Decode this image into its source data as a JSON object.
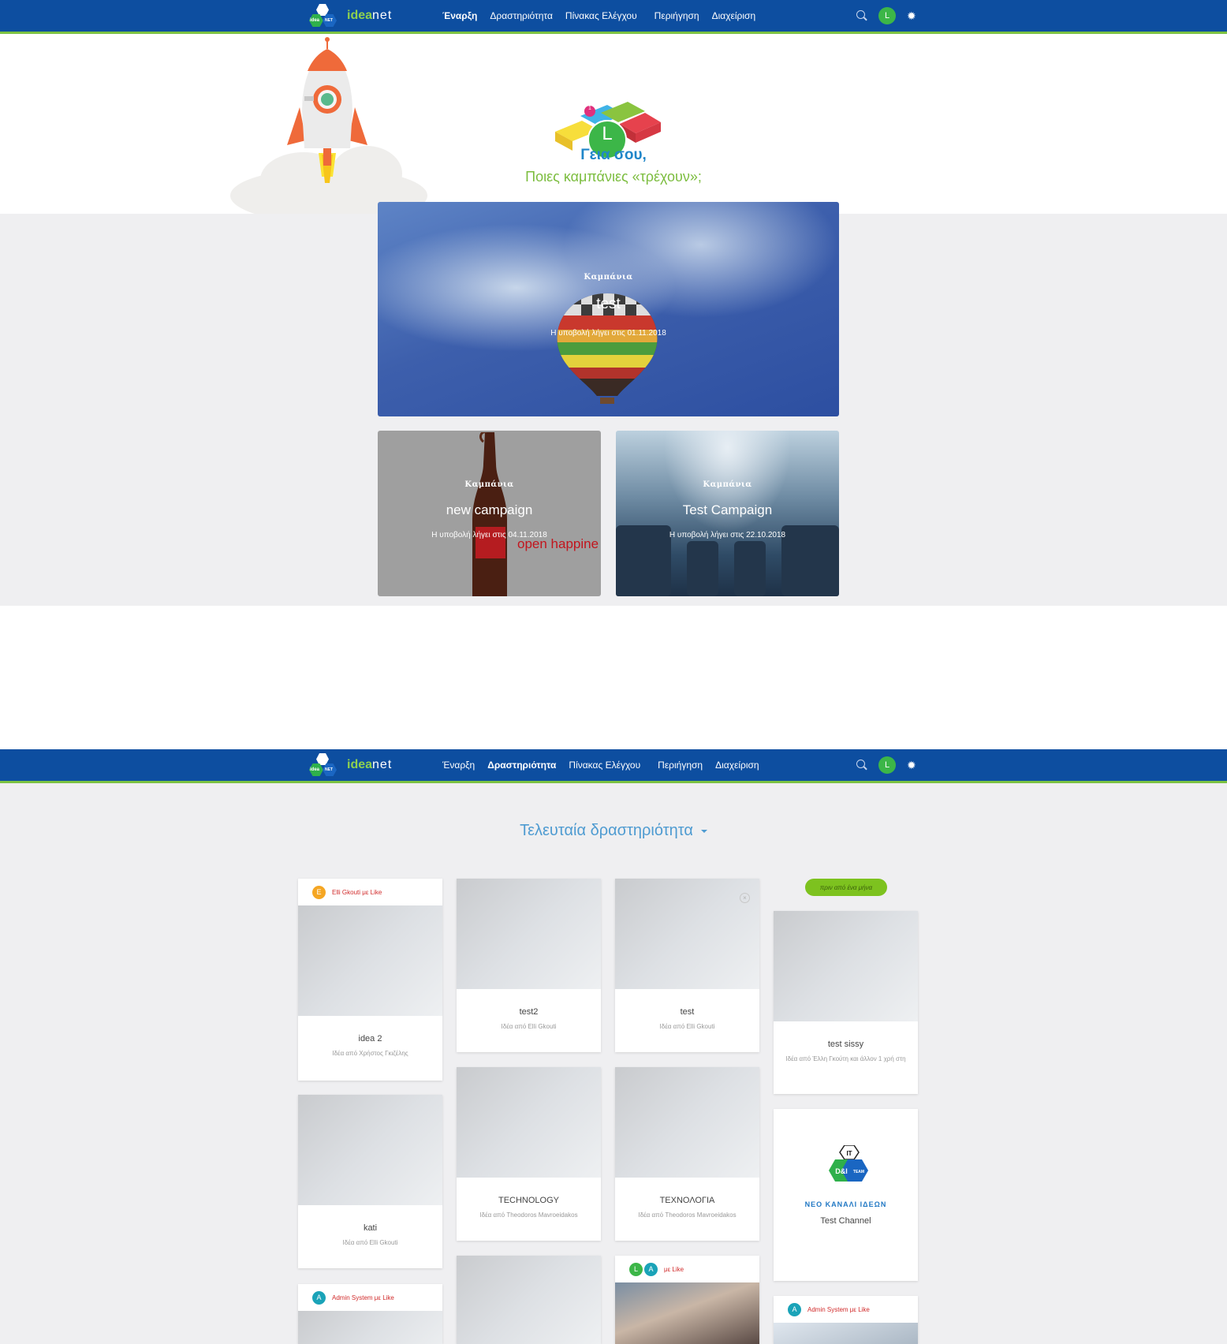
{
  "brand": {
    "logo_mark_left": "idea",
    "logo_mark_right": "NET",
    "wordmark_bold": "idea",
    "wordmark_rest": "net"
  },
  "nav": {
    "items": [
      "Έναρξη",
      "Δραστηριότητα",
      "Πίνακας Ελέγχου",
      "Περιήγηση",
      "Διαχείριση"
    ],
    "user_initial": "L",
    "icons": [
      "search-icon",
      "gear-icon"
    ]
  },
  "screen1": {
    "active_nav": "Έναρξη",
    "hero": {
      "greeting": "Γεια σου,",
      "subtitle": "Ποιες καμπάνιες «τρέχουν»;",
      "user_initial": "L",
      "badge_count": "1"
    },
    "campaigns": [
      {
        "label": "Καμπάνια",
        "title": "test",
        "deadline": "Η υποβολή λήγει στις 01.11.2018"
      },
      {
        "label": "Καμπάνια",
        "title": "new campaign",
        "deadline": "Η υποβολή λήγει στις 04.11.2018",
        "image_text": "open happine"
      },
      {
        "label": "Καμπάνια",
        "title": "Test Campaign",
        "deadline": "Η υποβολή λήγει στις 22.10.2018"
      }
    ]
  },
  "screen2": {
    "active_nav": "Δραστηριότητα",
    "activity_title": "Τελευταία δραστηριότητα",
    "time_pill": "πριν από ένα μήνα",
    "cards": [
      {
        "like_initial": "E",
        "like_text": "Elli Gkouti με Like",
        "title": "idea 2",
        "subtitle": "Ιδέα από Χρήστος Γκιζέλης"
      },
      {
        "title": "kati",
        "subtitle": "Ιδέα από Elli Gkouti"
      },
      {
        "like_initial": "A",
        "like_text": "Admin System με Like"
      },
      {
        "title": "test2",
        "subtitle": "Ιδέα από Elli Gkouti"
      },
      {
        "title": "TECHNOLOGY",
        "subtitle": "Ιδέα από Theodoros Mavroeidakos"
      },
      {
        "title": "test",
        "subtitle": "Ιδέα από Elli Gkouti",
        "close": "×"
      },
      {
        "title": "ΤΕΧΝΟΛΟΓΙΑ",
        "subtitle": "Ιδέα από Theodoros Mavroeidakos"
      },
      {
        "like_initials": [
          "L",
          "A"
        ],
        "like_text": "με Like"
      },
      {
        "title": "test sissy",
        "subtitle": "Ιδέα από Έλλη Γκούτη και άλλον 1 χρή στη"
      },
      {
        "channel_logo_text": "D&I",
        "channel_logo_sub": "TEAM",
        "channel_logo_top": "IT",
        "channel_heading": "ΝΕΟ ΚΑΝΑΛΙ ΙΔΕΩΝ",
        "channel_name": "Test Channel"
      },
      {
        "like_initial": "A",
        "like_text": "Admin System με Like"
      }
    ]
  },
  "colors": {
    "nav_bg": "#0d4ea0",
    "nav_accent": "#7cc242",
    "greeting_blue": "#1f86c9",
    "subtitle_green": "#7cbd3f",
    "like_red": "#d12b2b",
    "pill_green": "#7dc21f"
  }
}
